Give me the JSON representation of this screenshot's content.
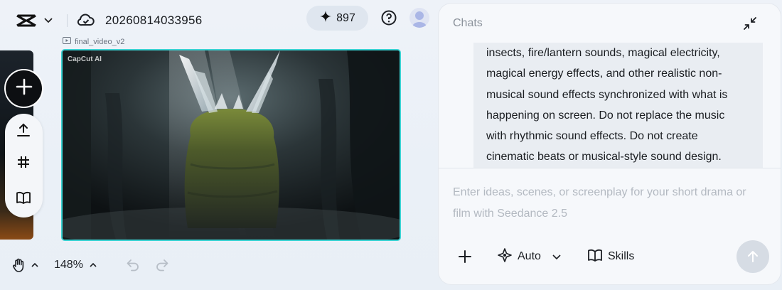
{
  "header": {
    "project_title": "20260814033956",
    "credits": "897"
  },
  "preview": {
    "file_label": "final_video_v2",
    "watermark": "CapCut AI"
  },
  "toolbar": {
    "zoom": "148%"
  },
  "chat": {
    "title": "Chats",
    "message_lines": [
      "insects, fire/lantern sounds, magical electricity,",
      "magical energy effects, and other realistic non-",
      "musical sound effects synchronized with what is",
      "happening on screen. Do not replace the music",
      "with rhythmic sound effects. Do not create",
      "cinematic beats or musical-style sound design."
    ],
    "input_placeholder": "Enter ideas, scenes, or screenplay for your short drama or film with Seedance 2.5",
    "mode_label": "Auto",
    "skills_label": "Skills"
  },
  "colors": {
    "accent_border": "#3bd3d3",
    "panel_bg": "#f6f8fb",
    "send_disabled": "#d6dce4"
  },
  "icons": [
    "capcut-logo-icon",
    "chevron-down-icon",
    "cloud-icon",
    "sparkle-icon",
    "help-icon",
    "avatar",
    "plus-icon",
    "upload-icon",
    "hashtag-icon",
    "book-icon",
    "video-file-icon",
    "hand-icon",
    "chevron-up-icon",
    "undo-icon",
    "redo-icon",
    "collapse-icon",
    "command-icon",
    "arrow-up-icon"
  ]
}
